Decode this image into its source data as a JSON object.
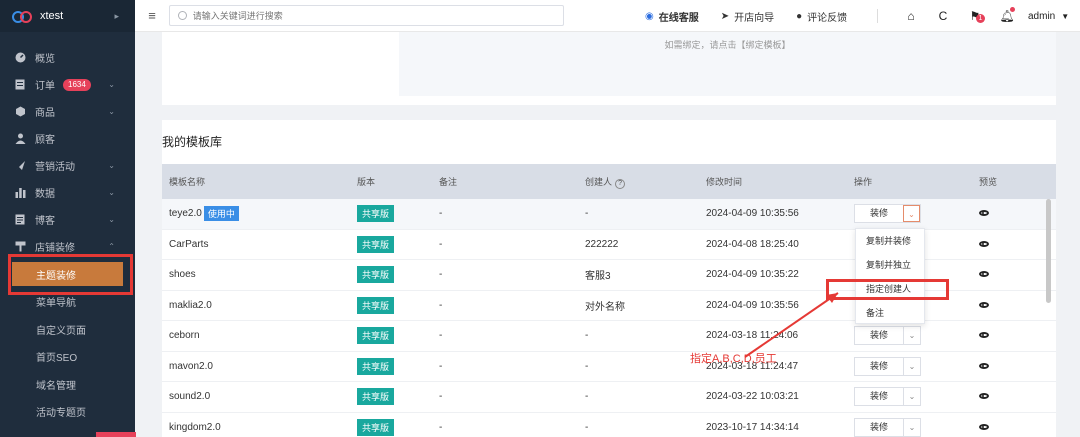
{
  "app": {
    "name": "xtest"
  },
  "sidebar": {
    "items": [
      {
        "label": "概览",
        "icon": "dashboard-icon"
      },
      {
        "label": "订单",
        "icon": "order-icon",
        "badge": "1634",
        "arrow": "⌄"
      },
      {
        "label": "商品",
        "icon": "product-icon",
        "arrow": "⌄"
      },
      {
        "label": "顾客",
        "icon": "user-icon"
      },
      {
        "label": "营销活动",
        "icon": "marketing-icon",
        "arrow": "⌄"
      },
      {
        "label": "数据",
        "icon": "chart-icon",
        "arrow": "⌄"
      },
      {
        "label": "博客",
        "icon": "blog-icon",
        "arrow": "⌄"
      },
      {
        "label": "店铺装修",
        "icon": "brush-icon",
        "arrow": "⌃"
      }
    ],
    "sub_items": [
      "主题装修",
      "菜单导航",
      "自定义页面",
      "首页SEO",
      "域名管理",
      "活动专题页"
    ]
  },
  "topbar": {
    "search_placeholder": "请输入关键词进行搜索",
    "actions": [
      "在线客服",
      "开店向导",
      "评论反馈"
    ],
    "notif_count": "1",
    "user": "admin"
  },
  "top_card": {
    "hint": "如需绑定，请点击【绑定模板】"
  },
  "library": {
    "title": "我的模板库",
    "headers": [
      "模板名称",
      "版本",
      "备注",
      "创建人",
      "修改时间",
      "操作",
      "预览"
    ],
    "in_use_label": "使用中",
    "op_label": "装修",
    "rows": [
      {
        "name": "teye2.0",
        "version": "共享版",
        "note": "-",
        "creator": "-",
        "time": "2024-04-09 10:35:56"
      },
      {
        "name": "CarParts",
        "version": "共享版",
        "note": "-",
        "creator": "222222",
        "time": "2024-04-08 18:25:40"
      },
      {
        "name": "shoes",
        "version": "共享版",
        "note": "-",
        "creator": "客服3",
        "time": "2024-04-09 10:35:22"
      },
      {
        "name": "maklia2.0",
        "version": "共享版",
        "note": "-",
        "creator": "对外名称",
        "time": "2024-04-09 10:35:56"
      },
      {
        "name": "ceborn",
        "version": "共享版",
        "note": "-",
        "creator": "-",
        "time": "2024-03-18 11:24:06"
      },
      {
        "name": "mavon2.0",
        "version": "共享版",
        "note": "-",
        "creator": "-",
        "time": "2024-03-18 11:24:47"
      },
      {
        "name": "sound2.0",
        "version": "共享版",
        "note": "-",
        "creator": "-",
        "time": "2024-03-22 10:03:21"
      },
      {
        "name": "kingdom2.0",
        "version": "共享版",
        "note": "-",
        "creator": "-",
        "time": "2023-10-17 14:34:14"
      }
    ]
  },
  "dropdown": {
    "items": [
      "复制并装修",
      "复制并独立",
      "指定创建人",
      "备注"
    ]
  },
  "annotation": {
    "text": "指定A,B,C,D,员工"
  },
  "colors": {
    "sidebar_bg": "#1f2d3d",
    "active_orange": "#c87a3c",
    "badge_red": "#e6415a",
    "version_teal": "#19a89e",
    "annot_red": "#e53935"
  }
}
